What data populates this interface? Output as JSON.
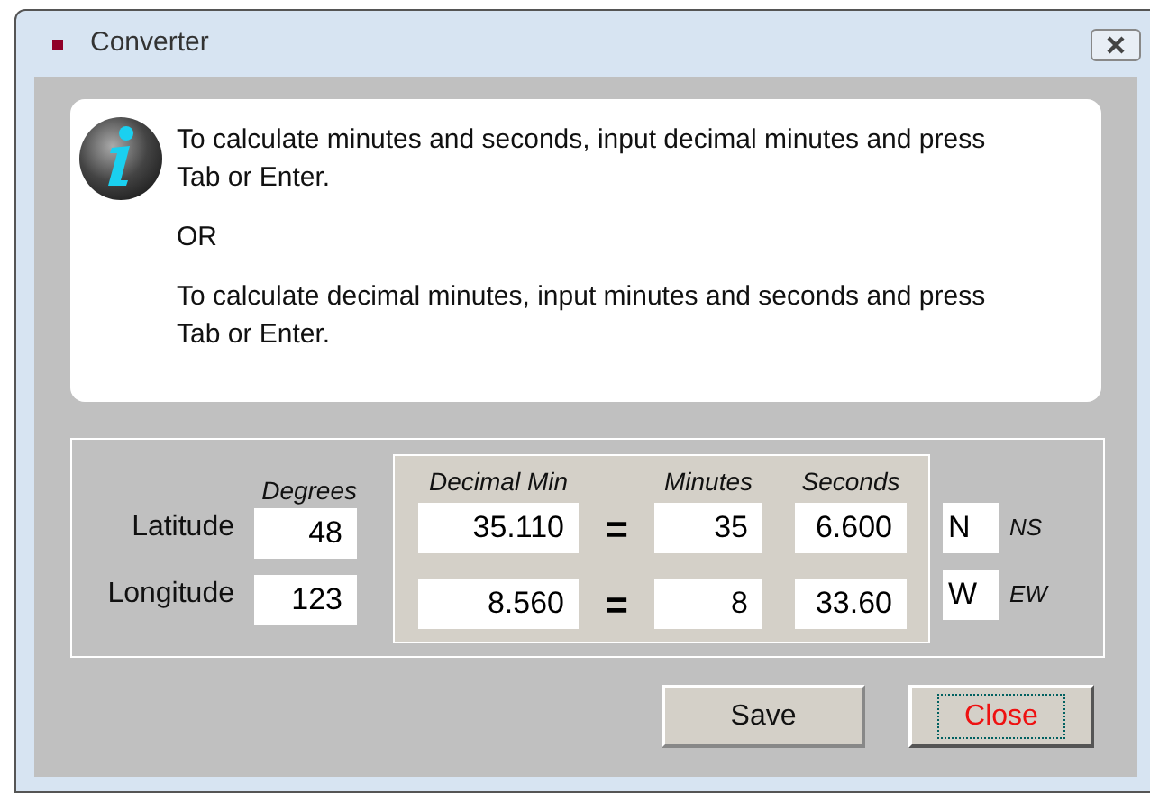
{
  "window": {
    "title": "Converter"
  },
  "info": {
    "paragraphs": [
      "To calculate minutes and seconds, input decimal minutes and press Tab or Enter.",
      "OR",
      "To calculate decimal minutes, input minutes and seconds and press Tab or Enter."
    ]
  },
  "columns": {
    "degrees": "Degrees",
    "decimal_min": "Decimal Min",
    "minutes": "Minutes",
    "seconds": "Seconds"
  },
  "rows": [
    {
      "label": "Latitude",
      "degrees": "48",
      "decimal_min": "35.110",
      "equals": "=",
      "minutes": "35",
      "seconds": "6.600",
      "hemisphere": "N",
      "hemisphere_hint": "NS"
    },
    {
      "label": "Longitude",
      "degrees": "123",
      "decimal_min": "8.560",
      "equals": "=",
      "minutes": "8",
      "seconds": "33.60",
      "hemisphere": "W",
      "hemisphere_hint": "EW"
    }
  ],
  "buttons": [
    {
      "label": "Save",
      "focused": false
    },
    {
      "label": "Close",
      "focused": true
    }
  ]
}
